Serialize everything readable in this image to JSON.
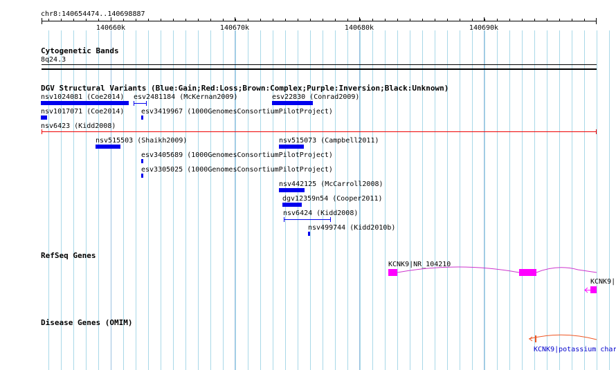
{
  "ruler": {
    "location": "chr8:140654474..140698887",
    "ticks": [
      "140660k",
      "140670k",
      "140680k",
      "140690k"
    ]
  },
  "tracks": {
    "cytogenetic": {
      "title": "Cytogenetic Bands",
      "band": "8q24.3"
    },
    "dgv": {
      "title": "DGV Structural Variants (Blue:Gain;Red:Loss;Brown:Complex;Purple:Inversion;Black:Unknown)",
      "features": [
        {
          "label": "nsv1024081 (Coe2014)"
        },
        {
          "label": "esv2481184 (McKernan2009)"
        },
        {
          "label": "esv22830 (Conrad2009)"
        },
        {
          "label": "nsv1017071 (Coe2014)"
        },
        {
          "label": "esv3419967 (1000GenomesConsortiumPilotProject)"
        },
        {
          "label": "nsv6423 (Kidd2008)"
        },
        {
          "label": "nsv515503 (Shaikh2009)"
        },
        {
          "label": "nsv515073 (Campbell2011)"
        },
        {
          "label": "esv3405689 (1000GenomesConsortiumPilotProject)"
        },
        {
          "label": "esv3305025 (1000GenomesConsortiumPilotProject)"
        },
        {
          "label": "nsv442125 (McCarroll2008)"
        },
        {
          "label": "dgv12359n54 (Cooper2011)"
        },
        {
          "label": "nsv6424 (Kidd2008)"
        },
        {
          "label": "nsv499744 (Kidd2010b)"
        }
      ]
    },
    "refseq": {
      "title": "RefSeq Genes",
      "genes": [
        {
          "label": "KCNK9|NR_104210"
        },
        {
          "label": "KCNK9|"
        }
      ]
    },
    "disease": {
      "title": "Disease Genes (OMIM)",
      "genes": [
        {
          "label": "KCNK9|potassium char"
        }
      ]
    }
  },
  "colors": {
    "gain": "#0000ee",
    "loss": "#ee0000",
    "refseq": "#ff00ff",
    "refseq_intron": "#cc33cc",
    "omim": "#ee5522",
    "grid": "#a8d8e8"
  }
}
